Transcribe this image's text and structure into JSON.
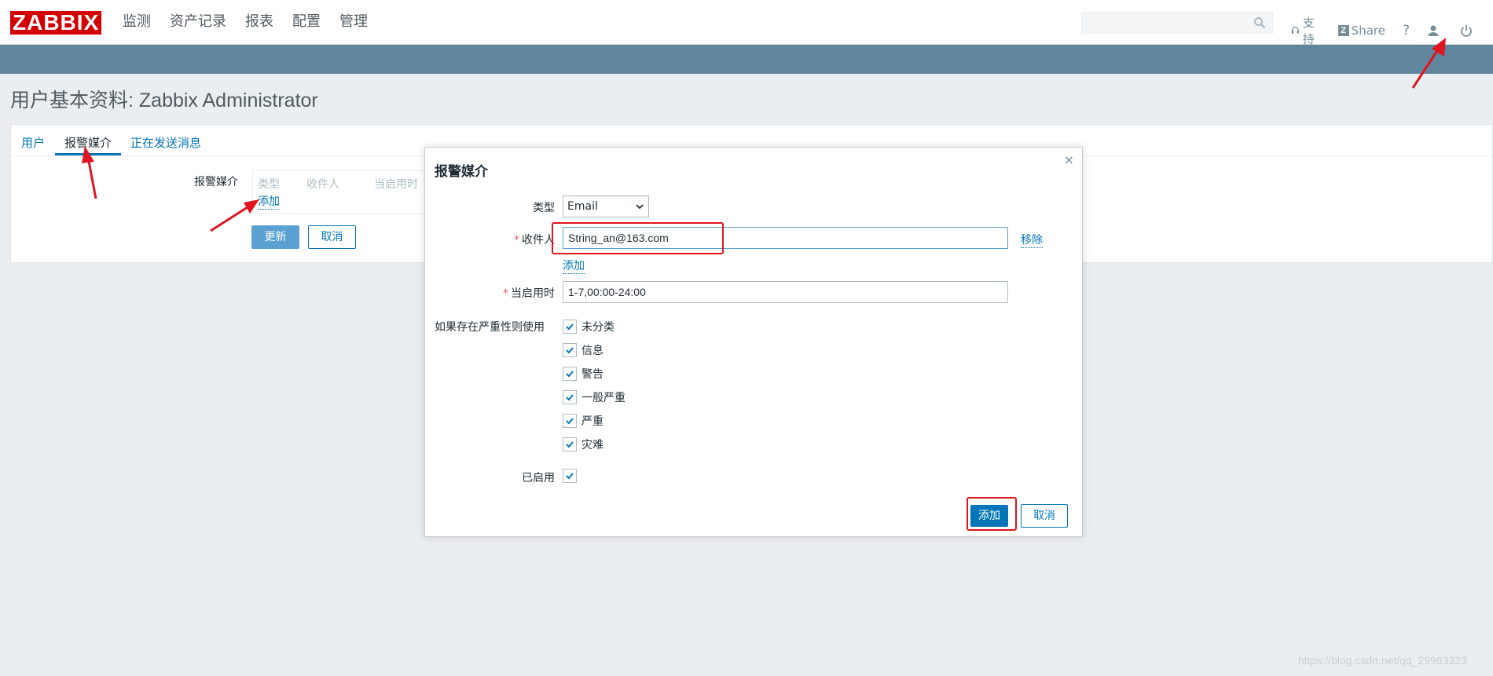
{
  "header": {
    "logo": "ZABBIX",
    "menu": [
      "监测",
      "资产记录",
      "报表",
      "配置",
      "管理"
    ],
    "search_placeholder": "",
    "support_label": "支持",
    "share_label": "Share",
    "help_label": "?"
  },
  "page": {
    "title": "用户基本资料: Zabbix Administrator"
  },
  "tabs": {
    "user": "用户",
    "media": "报警媒介",
    "messaging": "正在发送消息"
  },
  "media_form": {
    "label": "报警媒介",
    "col_type": "类型",
    "col_sendto": "收件人",
    "col_when": "当启用时",
    "add_link": "添加",
    "update_button": "更新",
    "cancel_button": "取消"
  },
  "dialog": {
    "title": "报警媒介",
    "close": "×",
    "type_label": "类型",
    "type_value": "Email",
    "sendto_label": "收件人",
    "sendto_value": "String_an@163.com",
    "remove_link": "移除",
    "add_link": "添加",
    "when_label": "当启用时",
    "when_value": "1-7,00:00-24:00",
    "severity_label": "如果存在严重性则使用",
    "severities": [
      {
        "label": "未分类",
        "checked": true
      },
      {
        "label": "信息",
        "checked": true
      },
      {
        "label": "警告",
        "checked": true
      },
      {
        "label": "一般严重",
        "checked": true
      },
      {
        "label": "严重",
        "checked": true
      },
      {
        "label": "灾难",
        "checked": true
      }
    ],
    "enabled_label": "已启用",
    "add_button": "添加",
    "cancel_button": "取消"
  },
  "watermark": "https://blog.csdn.net/qq_29963323",
  "colors": {
    "brand_red": "#d40000",
    "subbar": "#60869e",
    "link_blue": "#0275b8",
    "annotation_red": "#e0141e"
  }
}
